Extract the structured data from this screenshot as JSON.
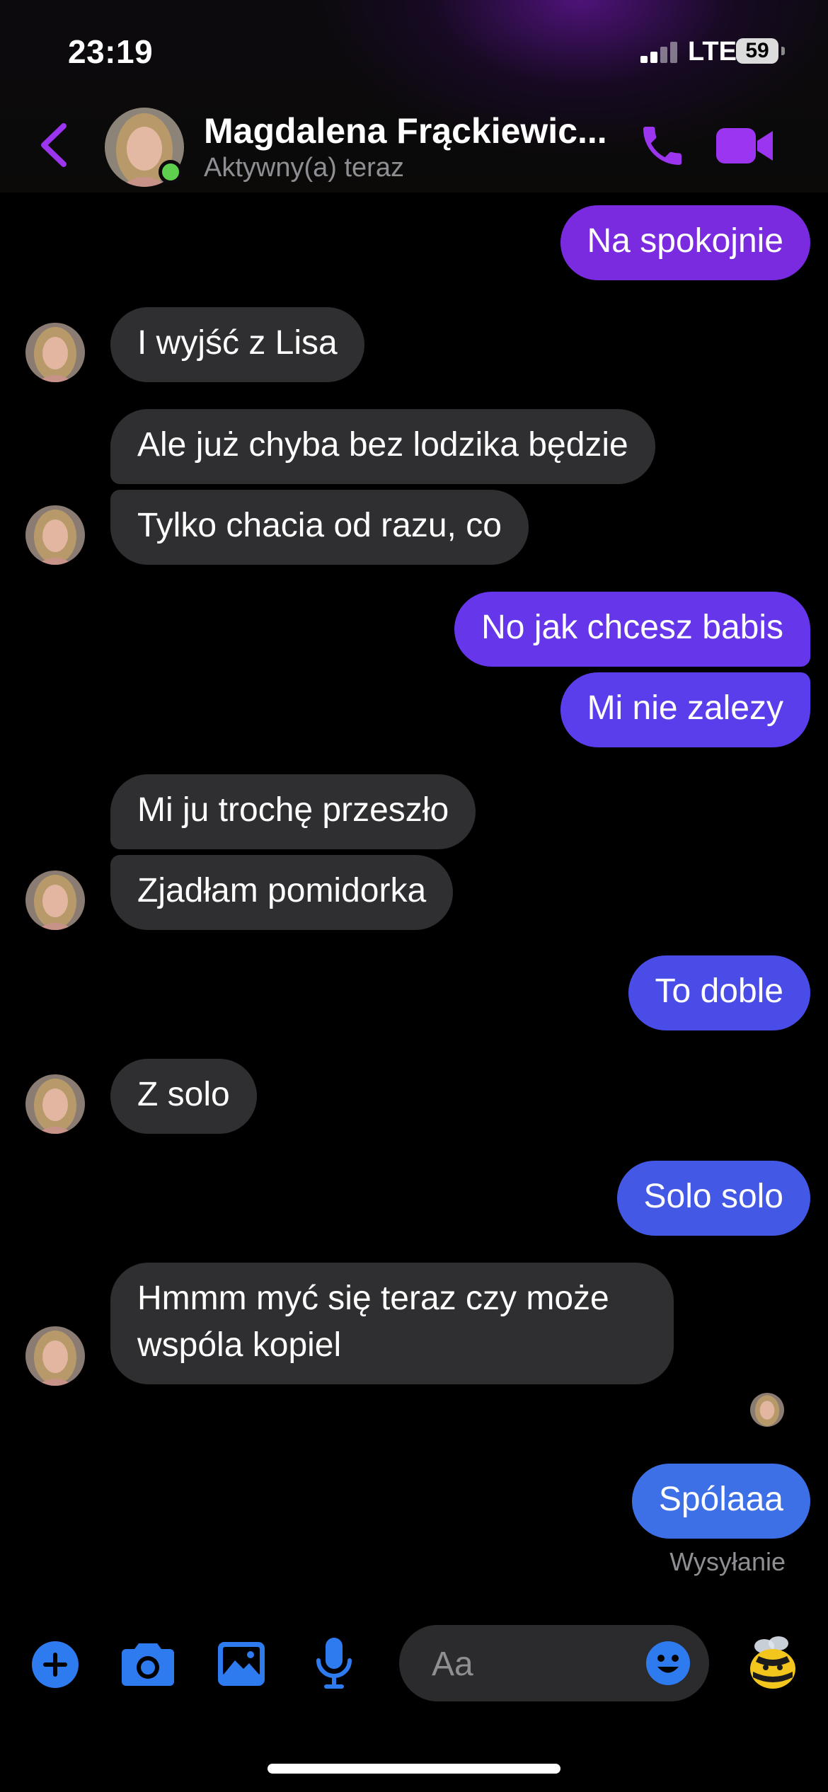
{
  "status_bar": {
    "time": "23:19",
    "network": "LTE",
    "battery": "59"
  },
  "header": {
    "contact_name": "Magdalena Frąckiewic...",
    "status": "Aktywny(a) teraz"
  },
  "messages": [
    {
      "dir": "out",
      "text": "Na spokojnie"
    },
    {
      "dir": "in",
      "text": "I wyjść z Lisa"
    },
    {
      "dir": "in",
      "text": "Ale już chyba bez lodzika będzie"
    },
    {
      "dir": "in",
      "text": "Tylko chacia od razu, co"
    },
    {
      "dir": "out",
      "text": "No jak chcesz babis"
    },
    {
      "dir": "out",
      "text": "Mi nie zalezy"
    },
    {
      "dir": "in",
      "text": "Mi ju trochę przeszło"
    },
    {
      "dir": "in",
      "text": "Zjadłam pomidorka"
    },
    {
      "dir": "out",
      "text": "To doble"
    },
    {
      "dir": "in",
      "text": "Z solo"
    },
    {
      "dir": "out",
      "text": "Solo solo"
    },
    {
      "dir": "in",
      "text": "Hmmm myć się teraz czy może",
      "text2": "wspóla kopiel"
    },
    {
      "dir": "out",
      "text": "Spólaaa"
    }
  ],
  "sending_status": "Wysyłanie",
  "composer": {
    "placeholder": "Aa"
  },
  "icons": {
    "back": "chevron-left-icon",
    "call": "phone-icon",
    "video": "video-camera-icon",
    "add": "plus-circle-icon",
    "camera": "camera-icon",
    "gallery": "image-icon",
    "mic": "microphone-icon",
    "emoji": "smiley-icon",
    "sticker": "bee-icon"
  },
  "colors": {
    "accent_purple": "#9b35f0",
    "outgoing_top": "#8a2be2",
    "outgoing_mid": "#5b3ff0",
    "outgoing_bottom": "#3d6fe6",
    "incoming": "#2f2f31",
    "toolbar_blue": "#2e7bf0"
  }
}
